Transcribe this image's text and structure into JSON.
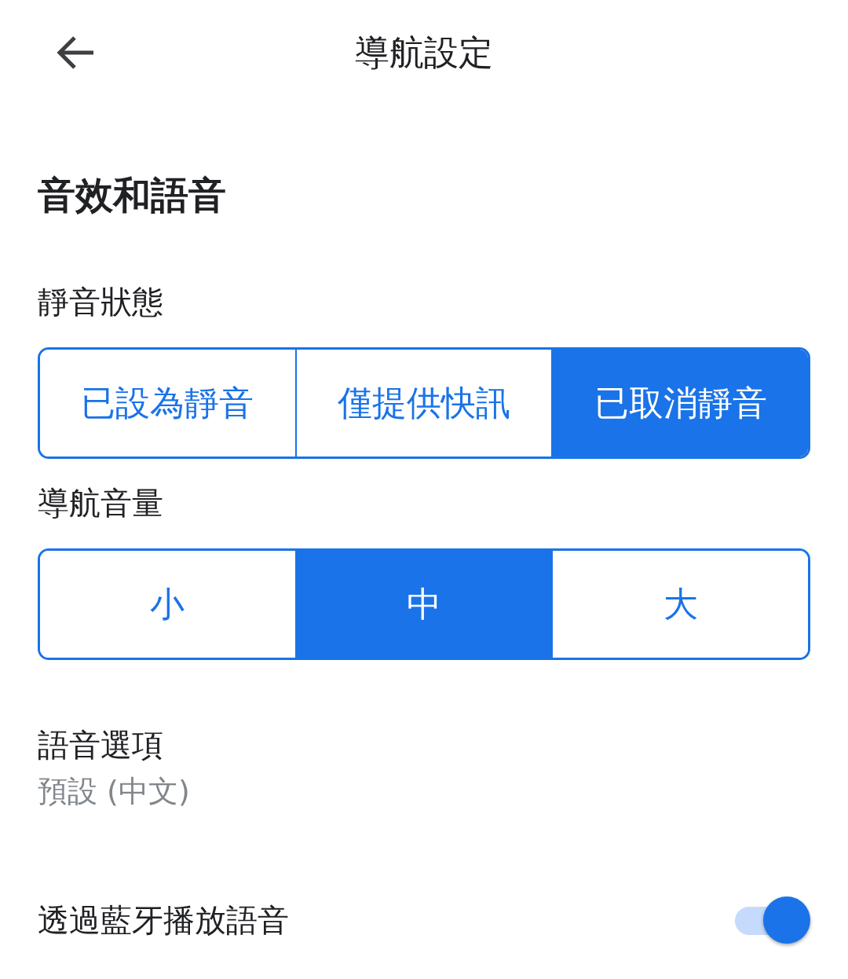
{
  "header": {
    "title": "導航設定"
  },
  "section": {
    "title": "音效和語音"
  },
  "mute_state": {
    "label": "靜音狀態",
    "options": [
      {
        "label": "已設為靜音",
        "selected": false
      },
      {
        "label": "僅提供快訊",
        "selected": false
      },
      {
        "label": "已取消靜音",
        "selected": true
      }
    ]
  },
  "volume": {
    "label": "導航音量",
    "options": [
      {
        "label": "小",
        "selected": false
      },
      {
        "label": "中",
        "selected": true
      },
      {
        "label": "大",
        "selected": false
      }
    ]
  },
  "voice": {
    "label": "語音選項",
    "value": "預設 (中文)"
  },
  "bluetooth": {
    "label": "透過藍牙播放語音",
    "on": true
  }
}
